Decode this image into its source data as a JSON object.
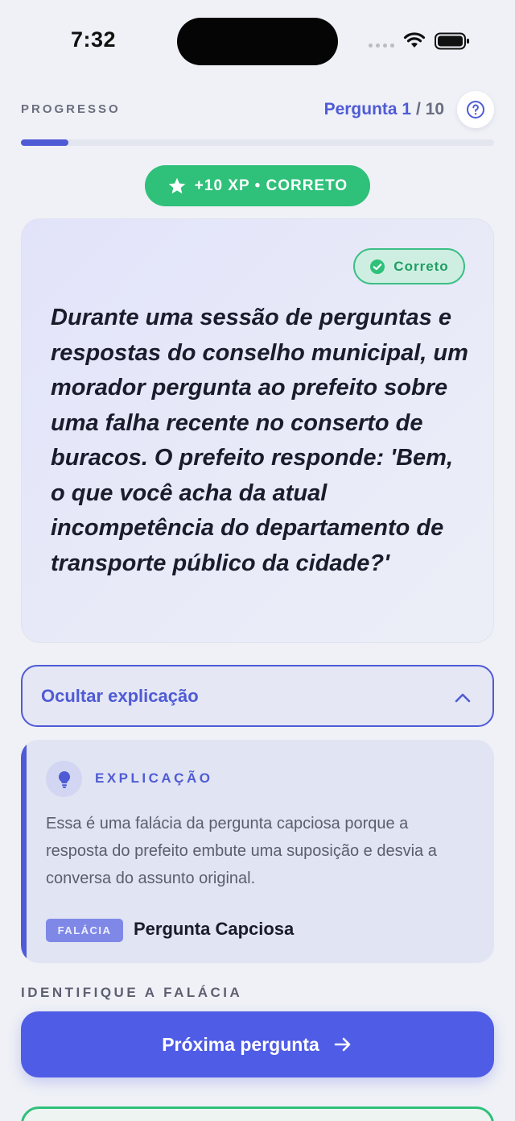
{
  "status_bar": {
    "time": "7:32",
    "icons": [
      "signal-dots-icon",
      "wifi-icon",
      "battery-icon"
    ]
  },
  "progress": {
    "label": "PROGRESSO",
    "question_word": "Pergunta",
    "current": "1",
    "separator": "/",
    "total": "10",
    "fraction_complete": 0.1,
    "help_icon": "question-circle-icon"
  },
  "xp_badge": {
    "text": "+10 XP • CORRETO",
    "icon": "star-icon",
    "color": "#2fc07a"
  },
  "question_card": {
    "status_badge": "Correto",
    "status_icon": "check-circle-icon",
    "text": "Durante uma sessão de perguntas e respostas do conselho municipal, um morador pergunta ao prefeito sobre uma falha recente no conserto de buracos. O prefeito responde: 'Bem, o que você acha da atual incompetência do departamento de transporte público da cidade?'"
  },
  "explanation_toggle": {
    "label": "Ocultar explicação",
    "icon": "chevron-up-icon"
  },
  "explanation": {
    "heading": "EXPLICAÇÃO",
    "icon": "lightbulb-icon",
    "body": "Essa é uma falácia da pergunta capciosa porque a resposta do prefeito embute uma suposição e desvia a conversa do assunto original.",
    "tag": "FALÁCIA",
    "fallacy_name": "Pergunta Capciosa"
  },
  "identify_label": "IDENTIFIQUE A FALÁCIA",
  "next_button": {
    "label": "Próxima pergunta",
    "icon": "arrow-right-icon"
  },
  "colors": {
    "accent": "#4f5bd5",
    "success": "#2fc07a",
    "background": "#eff1f6"
  }
}
